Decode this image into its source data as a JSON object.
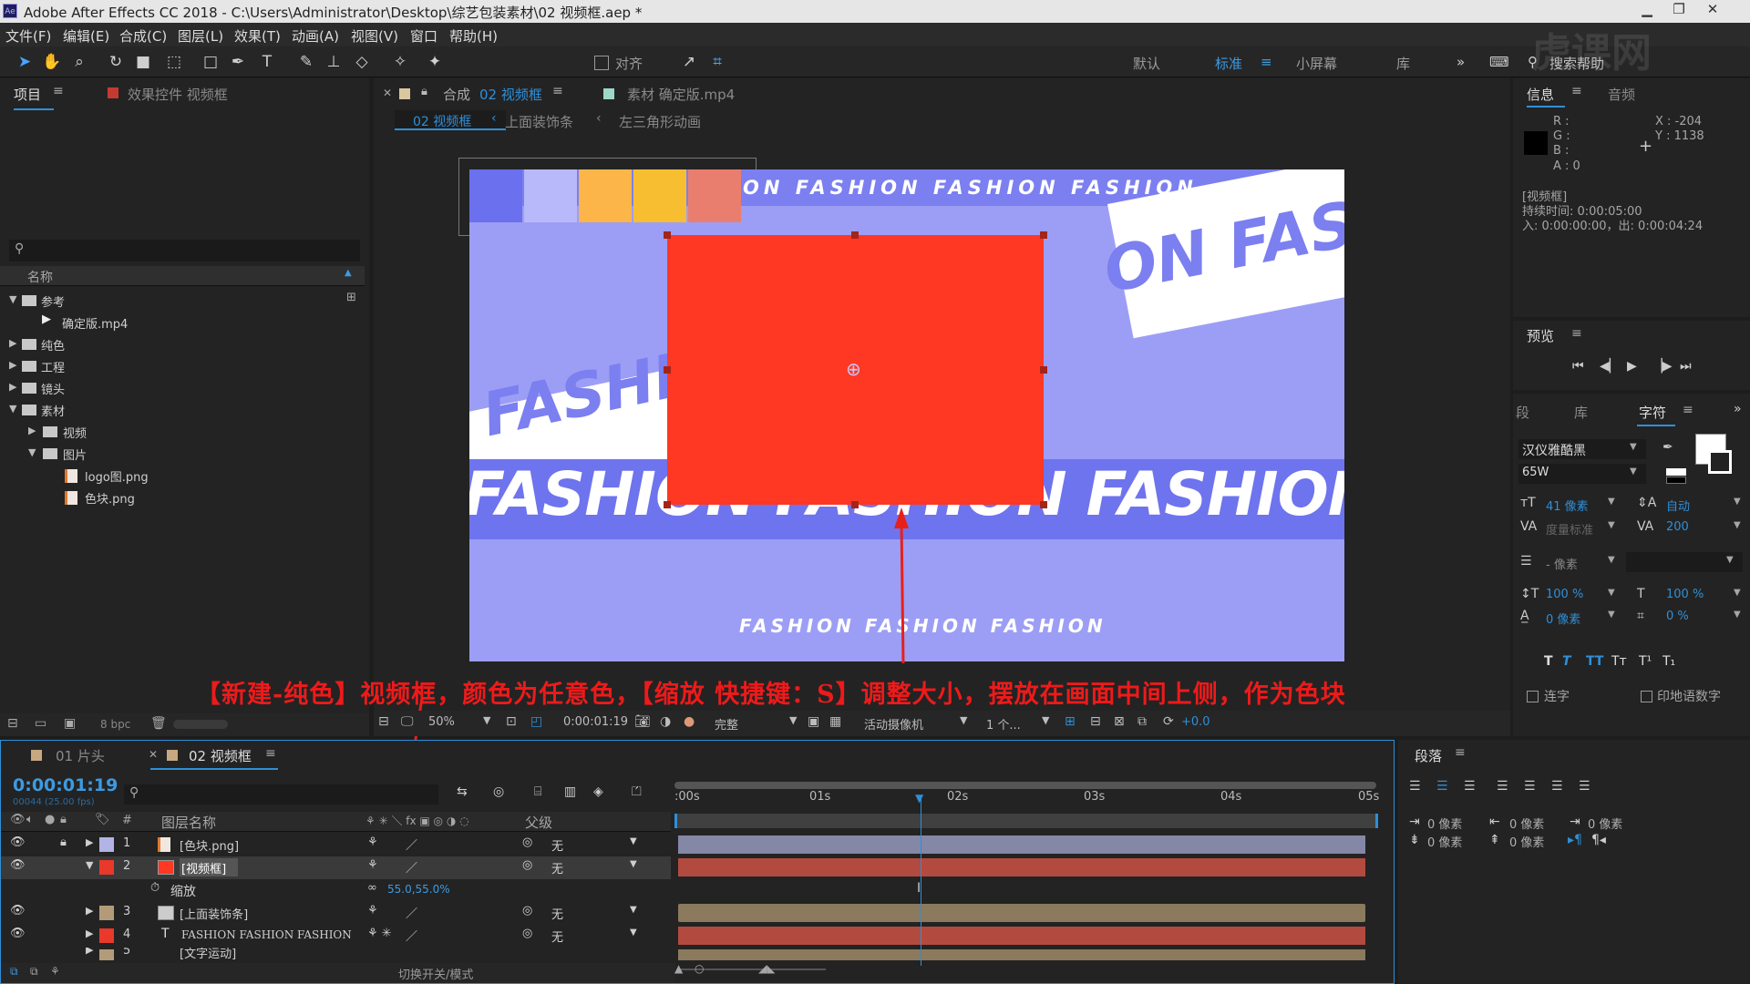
{
  "app": {
    "title": "Adobe After Effects CC 2018 - C:\\Users\\Administrator\\Desktop\\综艺包装素材\\02 视频框.aep *",
    "icon": "Ae"
  },
  "menu": [
    "文件(F)",
    "编辑(E)",
    "合成(C)",
    "图层(L)",
    "效果(T)",
    "动画(A)",
    "视图(V)",
    "窗口",
    "帮助(H)"
  ],
  "toolbar": {
    "align_label": "对齐",
    "workspaces": [
      "默认",
      "标准",
      "小屏幕",
      "库"
    ],
    "active_workspace": "标准",
    "search_placeholder": "搜索帮助"
  },
  "project_panel": {
    "tab": "项目",
    "effects_tab": "效果控件 视频框",
    "column_name": "名称",
    "bpc": "8 bpc",
    "items": [
      {
        "label": "参考",
        "type": "folder",
        "expanded": true,
        "depth": 0
      },
      {
        "label": "确定版.mp4",
        "type": "footage",
        "depth": 1
      },
      {
        "label": "纯色",
        "type": "folder",
        "expanded": false,
        "depth": 0
      },
      {
        "label": "工程",
        "type": "folder",
        "expanded": false,
        "depth": 0
      },
      {
        "label": "镜头",
        "type": "folder",
        "expanded": false,
        "depth": 0
      },
      {
        "label": "素材",
        "type": "folder",
        "expanded": true,
        "depth": 0
      },
      {
        "label": "视频",
        "type": "folder",
        "expanded": false,
        "depth": 1
      },
      {
        "label": "图片",
        "type": "folder",
        "expanded": true,
        "depth": 1
      },
      {
        "label": "logo图.png",
        "type": "image",
        "depth": 2
      },
      {
        "label": "色块.png",
        "type": "image",
        "depth": 2
      }
    ]
  },
  "comp_panel": {
    "tab_prefix": "合成",
    "tab_comp": "02 视频框",
    "footage_tab": "素材 确定版.mp4",
    "breadcrumbs": [
      "02 视频框",
      "上面装饰条",
      "左三角形动画"
    ],
    "canvas_texts": {
      "top_band": "ON FASHION FASHION FASHION",
      "right_diag": "ON FASH",
      "left_diag": "FASHIO",
      "big_band": "FASHION FASHION FASHION FASH",
      "bottom_small": "FASHION FASHION FASHION"
    },
    "solid_color": "#ff3823",
    "bg_color": "#9c9ef5",
    "caption": "【新建-纯色】视频框，颜色为任意色，【缩放 快捷键：S】调整大小，摆放在画面中间上侧，作为色块",
    "controls": {
      "zoom": "50%",
      "timecode": "0:00:01:19",
      "quality": "完整",
      "camera": "活动摄像机",
      "views": "1 个...",
      "exposure": "+0.0"
    }
  },
  "info_panel": {
    "tab": "信息",
    "audio_tab": "音频",
    "r": "R :",
    "g": "G :",
    "b": "B :",
    "a": "A : 0",
    "x": "X : -204",
    "y": "Y : 1138",
    "layer": "[视频框]",
    "duration": "持续时间: 0:00:05:00",
    "inout": "入: 0:00:00:00，出: 0:00:04:24"
  },
  "preview_panel": {
    "tab": "预览"
  },
  "char_panel": {
    "tabs": [
      "段",
      "库",
      "字符"
    ],
    "font": "汉仪雅酷黑",
    "weight": "65W",
    "size": "41 像素",
    "leading": "自动",
    "kerning": "度量标准",
    "tracking": "200",
    "stroke": "- 像素",
    "vscale": "100 %",
    "hscale": "100 %",
    "baseline": "0 像素",
    "tsume": "0 %",
    "ligature": "连字",
    "hindi": "印地语数字"
  },
  "para_panel": {
    "tab": "段落",
    "indent_values": [
      "0 像素",
      "0 像素",
      "0 像素",
      "0 像素",
      "0 像素"
    ]
  },
  "timeline": {
    "tabs": [
      "01 片头",
      "02 视频框"
    ],
    "timecode": "0:00:01:19",
    "frames": "00044 (25.00 fps)",
    "col_layer": "图层名称",
    "col_parent": "父级",
    "toggle_label": "切换开关/模式",
    "layers": [
      {
        "num": "1",
        "name": "[色块.png]",
        "color": "#b3b3e6",
        "parent": "无",
        "icon": "image"
      },
      {
        "num": "2",
        "name": "[视频框]",
        "color": "#e8392a",
        "parent": "无",
        "icon": "solid",
        "selected": true
      },
      {
        "num": "",
        "name": "缩放",
        "value": "55.0,55.0%",
        "property": true
      },
      {
        "num": "3",
        "name": "[上面装饰条]",
        "color": "#b39b7a",
        "parent": "无",
        "icon": "comp"
      },
      {
        "num": "4",
        "name": "FASHION FASHION FASHION",
        "color": "#e8392a",
        "parent": "无",
        "icon": "text"
      },
      {
        "num": "5",
        "name": "[文字运动]",
        "color": "#b39b7a",
        "parent": "",
        "icon": "comp"
      }
    ],
    "ruler": [
      ":00s",
      "01s",
      "02s",
      "03s",
      "04s",
      "05s"
    ],
    "playhead_fraction": 0.316
  }
}
